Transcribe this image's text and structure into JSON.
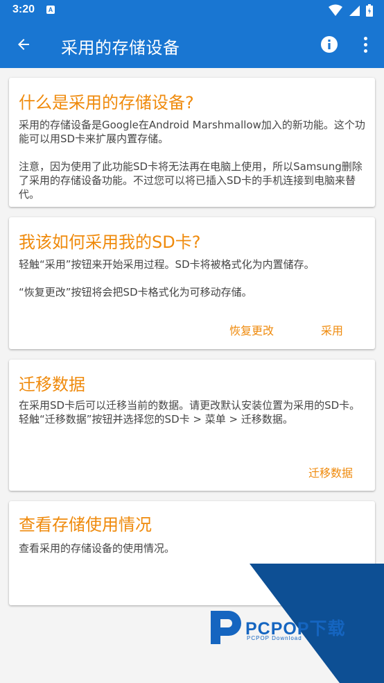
{
  "status_bar": {
    "time": "3:20",
    "notification_icon": "A"
  },
  "app_bar": {
    "title": "采用的存储设备"
  },
  "cards": [
    {
      "title": "什么是采用的存储设备?",
      "paragraphs": [
        "采用的存储设备是Google在Android Marshmallow加入的新功能。这个功能可以用SD卡来扩展内置存储。",
        "注意，因为使用了此功能SD卡将无法再在电脑上使用，所以Samsung删除了采用的存储设备功能。不过您可以将已插入SD卡的手机连接到电脑来替代。"
      ]
    },
    {
      "title": "我该如何采用我的SD卡?",
      "paragraphs": [
        "轻触“采用”按钮来开始采用过程。SD卡将被格式化为内置储存。",
        "“恢复更改”按钮将会把SD卡格式化为可移动存储。"
      ],
      "actions": [
        "恢复更改",
        "采用"
      ]
    },
    {
      "title": "迁移数据",
      "paragraphs": [
        "在采用SD卡后可以迁移当前的数据。请更改默认安装位置为采用的SD卡。轻触“迁移数据”按钮并选择您的SD卡 > 菜单 > 迁移数据。"
      ],
      "actions": [
        "迁移数据"
      ]
    },
    {
      "title": "查看存储使用情况",
      "paragraphs": [
        "查看采用的存储设备的使用情况。"
      ]
    }
  ],
  "watermark": {
    "brand": "PCPOP下载",
    "sub": "PCPOP Download"
  },
  "colors": {
    "primary": "#1976d2",
    "accent": "#ef8a0c",
    "background": "#f4f4f4",
    "watermark": "#0d4f94"
  }
}
